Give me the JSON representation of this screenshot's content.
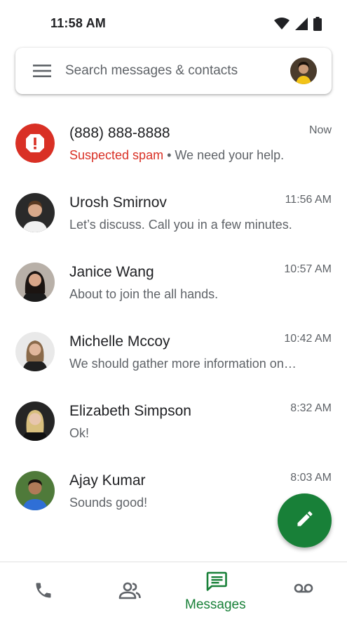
{
  "status_bar": {
    "time": "11:58 AM",
    "icons": [
      "wifi-icon",
      "cell-signal-icon",
      "battery-icon"
    ]
  },
  "search": {
    "placeholder": "Search messages & contacts",
    "icons": [
      "menu-icon",
      "account-avatar"
    ]
  },
  "conversations": [
    {
      "name": "(888) 888-8888",
      "spam_label": "Suspected spam",
      "separator": " • ",
      "snippet": "We need your help.",
      "time": "Now",
      "avatar": "spam-warning-icon"
    },
    {
      "name": "Urosh Smirnov",
      "snippet": "Let’s discuss. Call you in a few minutes.",
      "time": "11:56 AM",
      "avatar": "contact-photo"
    },
    {
      "name": "Janice Wang",
      "snippet": "About to join the all hands.",
      "time": "10:57 AM",
      "avatar": "contact-photo"
    },
    {
      "name": "Michelle Mccoy",
      "snippet": "We should gather more information on…",
      "time": "10:42 AM",
      "avatar": "contact-photo"
    },
    {
      "name": "Elizabeth Simpson",
      "snippet": "Ok!",
      "time": "8:32 AM",
      "avatar": "contact-photo"
    },
    {
      "name": "Ajay Kumar",
      "snippet": "Sounds good!",
      "time": "8:03 AM",
      "avatar": "contact-photo"
    }
  ],
  "fab": {
    "icon": "pencil-icon"
  },
  "bottom_nav": {
    "items": [
      {
        "icon": "phone-icon",
        "label": ""
      },
      {
        "icon": "contacts-icon",
        "label": ""
      },
      {
        "icon": "messages-icon",
        "label": "Messages",
        "active": true
      },
      {
        "icon": "voicemail-icon",
        "label": ""
      }
    ]
  },
  "colors": {
    "accent_green": "#188038",
    "spam_red": "#d93025",
    "secondary_text": "#5f6368",
    "icon_gray": "#5f6368"
  }
}
